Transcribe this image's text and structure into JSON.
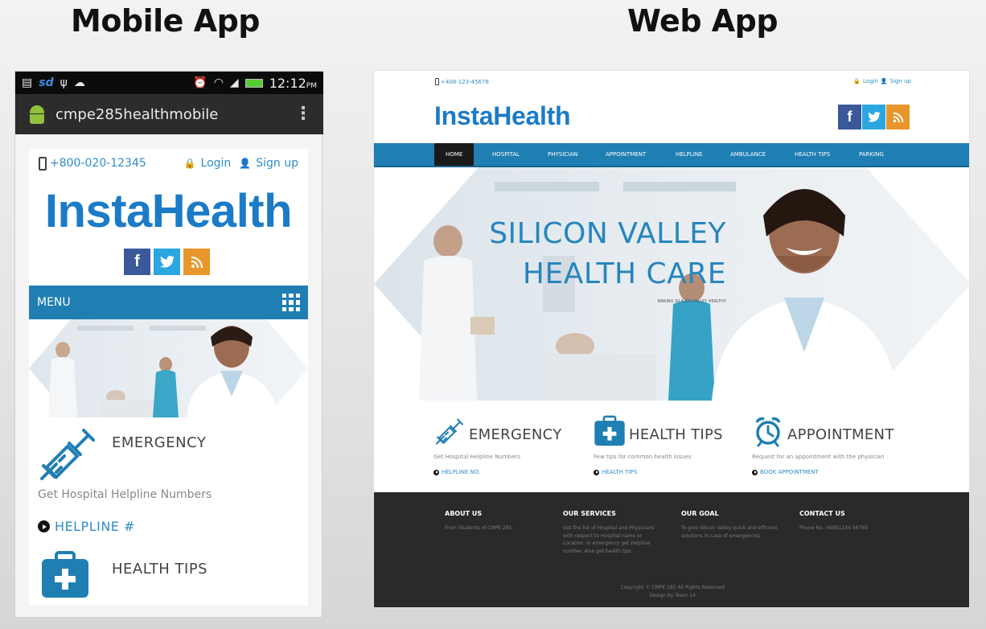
{
  "slide": {
    "mobile_heading": "Mobile App",
    "web_heading": "Web App"
  },
  "mobile": {
    "status_bar": {
      "time": "12:12",
      "ampm": "PM",
      "sd_label": "sd"
    },
    "app_bar": {
      "title": "cmpe285healthmobile"
    },
    "top_bar": {
      "phone": "+800-020-12345",
      "login": "Login",
      "signup": "Sign up"
    },
    "logo": "InstaHealth",
    "social": {
      "facebook": "f",
      "twitter": "t",
      "rss": "rss-icon"
    },
    "menu_label": "MENU",
    "services": {
      "emergency": {
        "title": "EMERGENCY",
        "description": "Get Hospital Helpline Numbers",
        "link": "HELPLINE #"
      },
      "health_tips": {
        "title": "HEALTH TIPS"
      }
    }
  },
  "web": {
    "top_bar": {
      "phone": "+408-123-45678",
      "login": "Login",
      "signup": "Sign up"
    },
    "logo": "InstaHealth",
    "social": {
      "facebook": "f",
      "twitter": "t"
    },
    "nav": [
      {
        "label": "HOME",
        "active": true
      },
      {
        "label": "HOSPITAL"
      },
      {
        "label": "PHYSICIAN"
      },
      {
        "label": "APPOINTMENT"
      },
      {
        "label": "HELPLINE"
      },
      {
        "label": "AMBULANCE"
      },
      {
        "label": "HEALTH TIPS"
      },
      {
        "label": "PARKING"
      }
    ],
    "hero": {
      "line1": "SILICON VALLEY",
      "line2": "HEALTH CARE",
      "tagline": "MAKING SILICON VALLEY HEALTHY"
    },
    "services": [
      {
        "title": "EMERGENCY",
        "description": "Get Hospital Helpline Numbers",
        "link": "HELPLINE NO."
      },
      {
        "title": "HEALTH TIPS",
        "description": "Few tips for common health issues",
        "link": "HEALTH TIPS"
      },
      {
        "title": "APPOINTMENT",
        "description": "Request for an appointment with the physician",
        "link": "BOOK APPOINTMENT"
      }
    ],
    "footer": {
      "columns": [
        {
          "heading": "ABOUT US",
          "text": "From Students of CMPE 285"
        },
        {
          "heading": "OUR SERVICES",
          "text": "Get the list of Hospital and Physicians with respect to Hospital name or Location. In emergency get Helpline number. Also get health tips"
        },
        {
          "heading": "OUR GOAL",
          "text": "To give Silicon Valley quick and efficient solutions in case of emergencies"
        },
        {
          "heading": "CONTACT US",
          "text": "Phone No. (408)1234 56789"
        }
      ],
      "copyright": "Copyright © CMPE 285 All Rights Reserved",
      "designed_by": "Design by Team 14"
    }
  },
  "colors": {
    "brand_blue": "#1c7bc6",
    "nav_blue": "#1f7fb3",
    "link_blue": "#2f8ec6",
    "footer_bg": "#2a2a2a",
    "facebook": "#3b5998",
    "twitter": "#2ba6e1",
    "rss": "#e8962b"
  }
}
